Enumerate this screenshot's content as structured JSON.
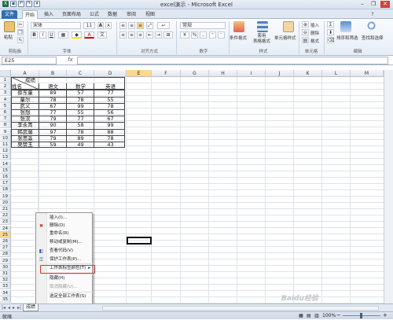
{
  "window": {
    "title": "excel演示 - Microsoft Excel",
    "minimize": "–",
    "restore": "❐",
    "close": "✕"
  },
  "tabs": [
    "文件",
    "开始",
    "插入",
    "页面布局",
    "公式",
    "数据",
    "审阅",
    "视图"
  ],
  "ribbon": {
    "clipboard": {
      "paste": "粘贴",
      "label": "剪贴板"
    },
    "font": {
      "name": "宋体",
      "size": "11",
      "label": "字体",
      "bold": "B",
      "italic": "I",
      "underline": "U",
      "grow": "A",
      "shrink": "A",
      "phonetic": "文"
    },
    "alignment": {
      "label": "对齐方式"
    },
    "number": {
      "format": "常规",
      "label": "数字",
      "percent": "%",
      "comma": ",",
      "currency": "¥"
    },
    "styles": {
      "label": "样式",
      "cond": "条件格式",
      "table": "套用\n表格格式",
      "cell": "单元格样式"
    },
    "cells": {
      "label": "单元格",
      "insert": "插入",
      "delete": "删除",
      "format": "格式"
    },
    "editing": {
      "label": "编辑",
      "sort": "排序和筛选",
      "find": "查找和选择",
      "sum": "Σ"
    }
  },
  "formula_bar": {
    "name_box": "E25",
    "fx": "fx",
    "value": ""
  },
  "columns": [
    "A",
    "B",
    "C",
    "D",
    "E",
    "F",
    "G",
    "H",
    "I",
    "J",
    "K",
    "L",
    "M"
  ],
  "rows": [
    "1",
    "2",
    "3",
    "4",
    "5",
    "6",
    "7",
    "8",
    "9",
    "10",
    "11",
    "12",
    "13",
    "14",
    "15",
    "16",
    "17",
    "18",
    "19",
    "20",
    "21",
    "22",
    "23",
    "24",
    "25",
    "26",
    "27",
    "28",
    "29",
    "30",
    "31",
    "32",
    "33",
    "34",
    "35"
  ],
  "table": {
    "header_top": "成绩",
    "header_bottom": "姓名",
    "subjects": [
      "语文",
      "数学",
      "英语"
    ],
    "records": [
      {
        "name": "薛东童",
        "scores": [
          "89",
          "57",
          "77"
        ]
      },
      {
        "name": "童尔",
        "scores": [
          "78",
          "78",
          "55"
        ]
      },
      {
        "name": "武义",
        "scores": [
          "67",
          "99",
          "78"
        ]
      },
      {
        "name": "张想",
        "scores": [
          "77",
          "55",
          "56"
        ]
      },
      {
        "name": "张滨",
        "scores": [
          "79",
          "77",
          "67"
        ]
      },
      {
        "name": "李永青",
        "scores": [
          "90",
          "58",
          "99"
        ]
      },
      {
        "name": "韩武馨",
        "scores": [
          "97",
          "78",
          "88"
        ]
      },
      {
        "name": "张思淼",
        "scores": [
          "79",
          "89",
          "78"
        ]
      },
      {
        "name": "吴赞玉",
        "scores": [
          "59",
          "49",
          "43"
        ]
      }
    ]
  },
  "context_menu": [
    {
      "label": "插入(I)...",
      "disabled": false
    },
    {
      "label": "删除(D)",
      "disabled": false
    },
    {
      "label": "重命名(R)",
      "disabled": false
    },
    {
      "label": "移动或复制(M)...",
      "disabled": false
    },
    {
      "label": "查看代码(V)",
      "disabled": false
    },
    {
      "label": "保护工作表(P)...",
      "disabled": false
    },
    {
      "label": "工作表标签颜色(T)",
      "disabled": false,
      "submenu": "▸"
    },
    {
      "label": "隐藏(H)",
      "disabled": false
    },
    {
      "label": "取消隐藏(U)...",
      "disabled": true
    },
    {
      "label": "选定全部工作表(S)",
      "disabled": false
    }
  ],
  "sheet_tab": "成绩",
  "status": {
    "ready": "就绪",
    "zoom": "100%",
    "minus": "−",
    "plus": "+"
  },
  "watermark": "Baidu经验",
  "colors": {
    "accent": "#2f6db5",
    "highlight": "#e0302c",
    "selected_header": "#fbd88b"
  }
}
